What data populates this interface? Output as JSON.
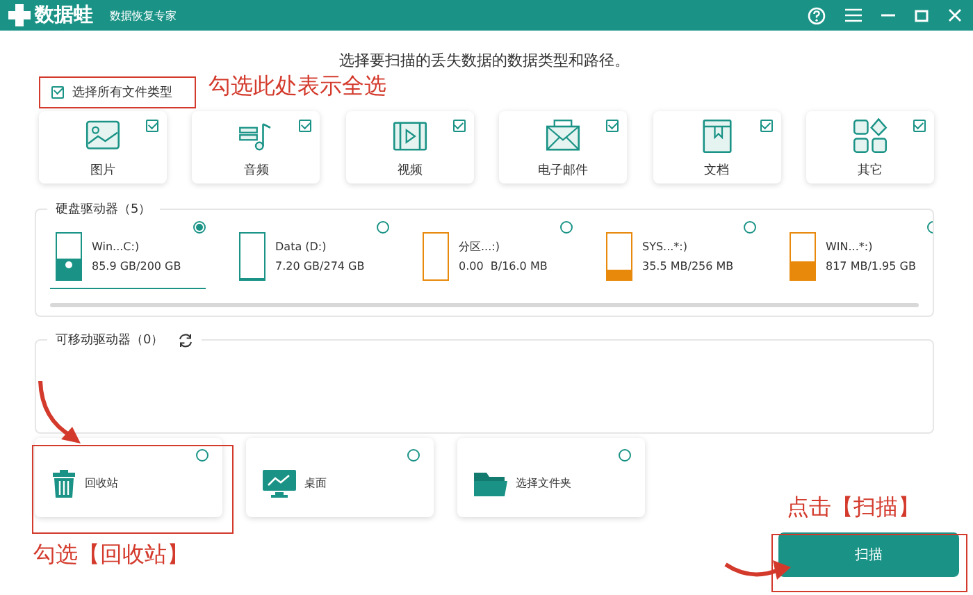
{
  "window": {
    "logo": "数据蛙",
    "subtitle": "数据恢复专家"
  },
  "heading": "选择要扫描的丢失数据的数据类型和路径。",
  "select_all": {
    "label": "选择所有文件类型",
    "checked": true
  },
  "file_types": [
    {
      "kind": "image",
      "label": "图片",
      "checked": true
    },
    {
      "kind": "audio",
      "label": "音频",
      "checked": true
    },
    {
      "kind": "video",
      "label": "视频",
      "checked": true
    },
    {
      "kind": "email",
      "label": "电子邮件",
      "checked": true
    },
    {
      "kind": "document",
      "label": "文档",
      "checked": true
    },
    {
      "kind": "other",
      "label": "其它",
      "checked": true
    }
  ],
  "hard_drives": {
    "title": "硬盘驱动器（5）",
    "drives": [
      {
        "name": "Win...C:)",
        "size": "85.9 GB/200 GB",
        "level": 0.45,
        "color": "#1a9386",
        "system": true,
        "selected": true
      },
      {
        "name": "Data (D:)",
        "size": "7.20 GB/274 GB",
        "level": 0.03,
        "color": "#1a9386",
        "system": false,
        "selected": false
      },
      {
        "name": "分区...:)",
        "size": "0.00  B/16.0 MB",
        "level": 0,
        "color": "#e8890c",
        "system": false,
        "selected": false
      },
      {
        "name": "SYS...*:)",
        "size": "35.5 MB/256 MB",
        "level": 0.2,
        "color": "#e8890c",
        "system": false,
        "selected": false
      },
      {
        "name": "WIN...*:)",
        "size": "817 MB/1.95 GB",
        "level": 0.4,
        "color": "#e8890c",
        "system": false,
        "selected": false
      }
    ]
  },
  "removable": {
    "title": "可移动驱动器（0）"
  },
  "locations": [
    {
      "kind": "recycle",
      "label": "回收站",
      "selected": false
    },
    {
      "kind": "desktop",
      "label": "桌面",
      "selected": false
    },
    {
      "kind": "folder",
      "label": "选择文件夹",
      "selected": false
    }
  ],
  "scan_button": "扫描",
  "annotations": {
    "select_all_note": "勾选此处表示全选",
    "recycle_note": "勾选【回收站】",
    "scan_note": "点击【扫描】"
  }
}
